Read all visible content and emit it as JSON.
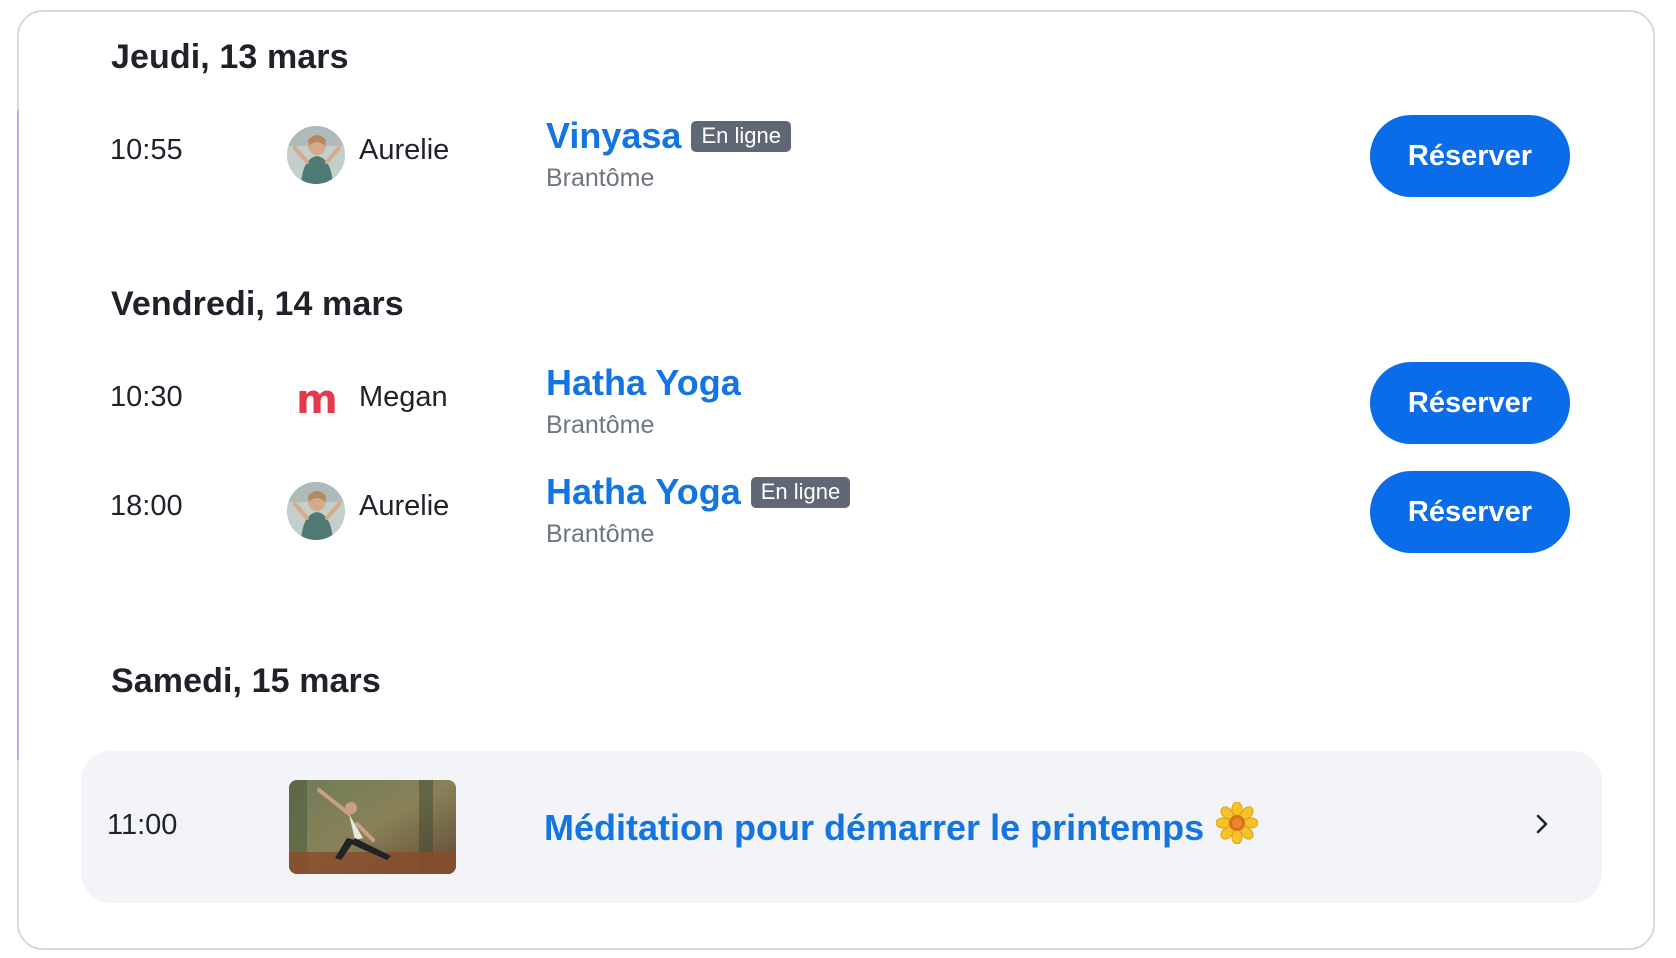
{
  "days": [
    {
      "heading": "Jeudi, 13 mars",
      "sessions": [
        {
          "time": "10:55",
          "teacher": "Aurelie",
          "teacher_avatar": "photo-avatar",
          "class": "Vinyasa",
          "badge": "En ligne",
          "location": "Brantôme",
          "button": "Réserver"
        }
      ]
    },
    {
      "heading": "Vendredi, 14 mars",
      "sessions": [
        {
          "time": "10:30",
          "teacher": "Megan",
          "teacher_logo": "m",
          "class": "Hatha Yoga",
          "badge": "",
          "location": "Brantôme",
          "button": "Réserver"
        },
        {
          "time": "18:00",
          "teacher": "Aurelie",
          "teacher_avatar": "photo-avatar",
          "class": "Hatha Yoga",
          "badge": "En ligne",
          "location": "Brantôme",
          "button": "Réserver"
        }
      ]
    },
    {
      "heading": "Samedi, 15 mars",
      "event": {
        "time": "11:00",
        "title": "Méditation pour démarrer le printemps",
        "emoji_icon": "flower-icon",
        "thumbnail": "yoga-photo",
        "chevron_icon": "chevron-right-icon"
      }
    }
  ],
  "colors": {
    "accent_blue": "#1474e0",
    "button_blue": "#0a6ce8",
    "badge_gray": "#5f6874",
    "megan_logo_red": "#e8374b",
    "event_card_bg": "#f2f4f8"
  }
}
